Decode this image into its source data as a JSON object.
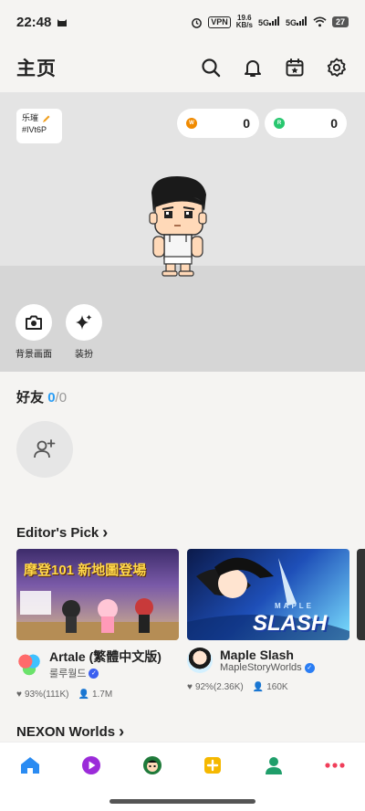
{
  "status_bar": {
    "time": "22:48",
    "vpn": "VPN",
    "speed_value": "19.6",
    "speed_unit": "KB/s",
    "signal1": "5G",
    "signal2": "5G",
    "battery": "27"
  },
  "header": {
    "title": "主页",
    "icons": [
      "search-icon",
      "bell-icon",
      "calendar-icon",
      "gear-icon"
    ]
  },
  "profile": {
    "name": "乐璀",
    "tag": "#IVt6P"
  },
  "currency": {
    "left_value": "0",
    "right_value": "0",
    "left_color": "#f08a00",
    "right_color": "#28c76f"
  },
  "hero_buttons": {
    "background_label": "背景画面",
    "outfit_label": "装扮"
  },
  "friends": {
    "title": "好友",
    "current": "0",
    "separator": "/",
    "total": "0"
  },
  "editors_pick": {
    "title": "Editor's Pick",
    "chevron": "›",
    "cards": [
      {
        "name": "Artale (繁體中文版)",
        "developer": "룰루월드",
        "rating": "93%(111K)",
        "players": "1.7M",
        "banner_text": "摩登101 新地圖登場"
      },
      {
        "name": "Maple Slash",
        "developer": "MapleStoryWorlds",
        "rating": "92%(2.36K)",
        "players": "160K",
        "banner_text": "SLASH",
        "banner_small": "MAPLE"
      }
    ]
  },
  "nexon_worlds": {
    "title": "NEXON Worlds",
    "chevron": "›"
  },
  "nav": {
    "items": [
      "home-icon",
      "play-icon",
      "avatar-icon",
      "add-icon",
      "friends-icon",
      "more-icon"
    ],
    "accent": "#2a8bf2"
  }
}
